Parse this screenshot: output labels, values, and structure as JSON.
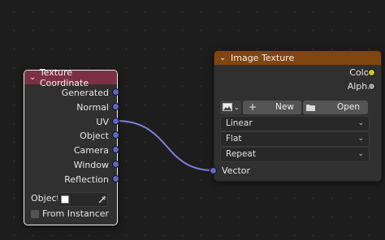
{
  "texture_coordinate_node": {
    "title": "Texture Coordinate",
    "outputs": [
      "Generated",
      "Normal",
      "UV",
      "Object",
      "Camera",
      "Window",
      "Reflection"
    ],
    "object_label": "Object:",
    "from_instancer_label": "From Instancer",
    "header_color": "#7b3046"
  },
  "image_texture_node": {
    "title": "Image Texture",
    "outputs": [
      "Color",
      "Alpha"
    ],
    "new_label": "New",
    "open_label": "Open",
    "interpolation": "Linear",
    "projection": "Flat",
    "extension": "Repeat",
    "input_label": "Vector",
    "header_color": "#81450f"
  },
  "colors": {
    "vector_socket": "#6363c7",
    "color_socket": "#c7c729",
    "float_socket": "#a1a1a1",
    "link": "#6a6ad0"
  }
}
